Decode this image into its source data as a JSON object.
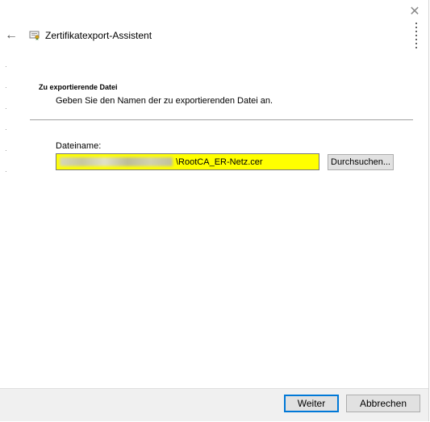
{
  "window": {
    "title": "Zertifikatexport-Assistent",
    "close_symbol": "✕",
    "back_symbol": "←"
  },
  "section": {
    "title": "Zu exportierende Datei",
    "description": "Geben Sie den Namen der zu exportierenden Datei an."
  },
  "file": {
    "label": "Dateiname:",
    "value": "\\RootCA_ER-Netz.cer",
    "browse_label": "Durchsuchen..."
  },
  "footer": {
    "next_label": "Weiter",
    "cancel_label": "Abbrechen"
  },
  "colors": {
    "input_highlight": "#ffff00",
    "primary_border": "#0078d7"
  }
}
